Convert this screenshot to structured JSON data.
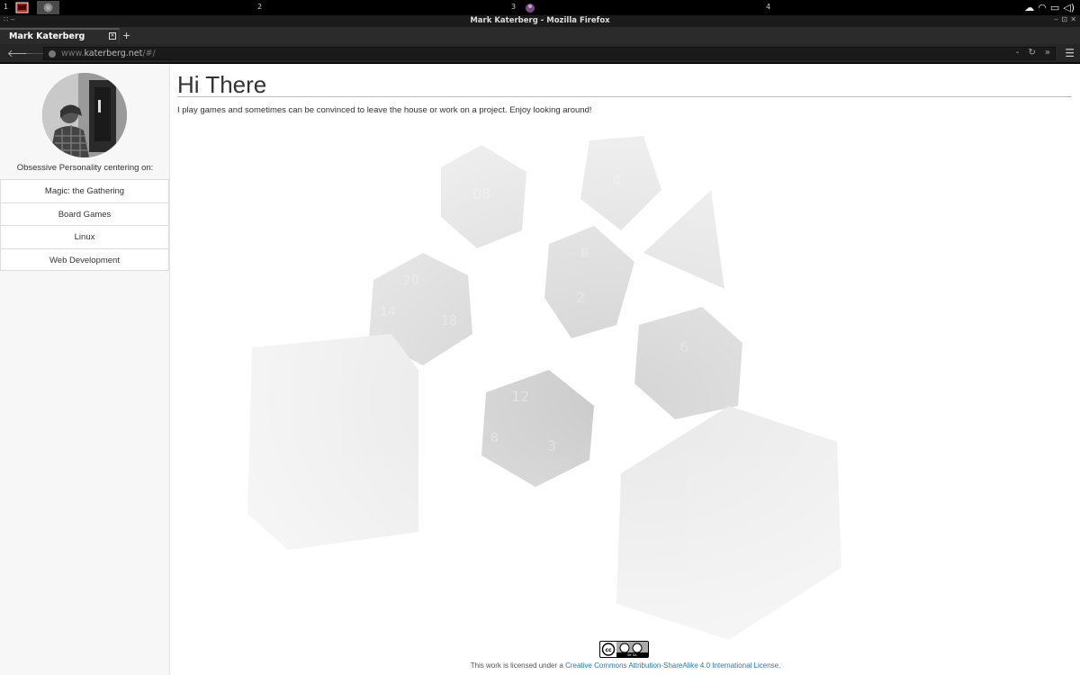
{
  "taskbar": {
    "workspaces": [
      "1",
      "2",
      "3",
      "4"
    ]
  },
  "window": {
    "title": "Mark Katerberg - Mozilla Firefox"
  },
  "tab": {
    "label": "Mark Katerberg",
    "new_tab_label": "+"
  },
  "navbar": {
    "url_prefix": "www.",
    "url_host": "katerberg.net",
    "url_suffix": "/#/"
  },
  "sidebar": {
    "tagline": "Obsessive Personality centering on:",
    "items": [
      {
        "label": "Magic: the Gathering"
      },
      {
        "label": "Board Games"
      },
      {
        "label": "Linux"
      },
      {
        "label": "Web Development"
      }
    ]
  },
  "main": {
    "heading": "Hi There",
    "intro": "I play games and sometimes can be convinced to leave the house or work on a project. Enjoy looking around!",
    "dice_labels": [
      "08",
      "4",
      "20",
      "14",
      "18",
      "2",
      "8",
      "12",
      "3",
      "8",
      "6"
    ]
  },
  "footer": {
    "text": "This work is licensed under a",
    "link_text": "Creative Commons Attribution-ShareAlike 4.0 International License.",
    "badge_text": "BY SA"
  },
  "colors": {
    "link": "#2a7ab0",
    "taskbar_bg": "#000000",
    "chrome_bg": "#2b2b2b"
  }
}
